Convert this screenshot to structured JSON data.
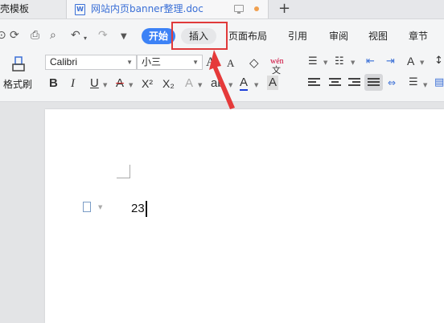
{
  "tabbar": {
    "left_tab_label": "稻壳模板",
    "doc_tab_label": "网站内页banner整理.doc",
    "doc_icon_glyph": "W",
    "new_tab_glyph": "+"
  },
  "ribbon": {
    "tabs": [
      "开始",
      "插入",
      "页面布局",
      "引用",
      "审阅",
      "视图",
      "章节"
    ],
    "active_tab": "开始",
    "highlighted_tab": "插入",
    "active_color": "#3c82f6",
    "highlight_color": "#e03a3a"
  },
  "toolbar": {
    "format_painter_label": "格式刷",
    "font_name": "Calibri",
    "font_size": "小三",
    "bold": "B",
    "italic": "I",
    "underline": "U",
    "strikethrough": "A",
    "superscript": "X²",
    "subscript": "X₂",
    "grow_font": "A",
    "shrink_font": "A",
    "font_color": "A",
    "char_shading": "A",
    "pinyin": "wén",
    "text_effects": "A"
  },
  "document": {
    "text": "23"
  }
}
